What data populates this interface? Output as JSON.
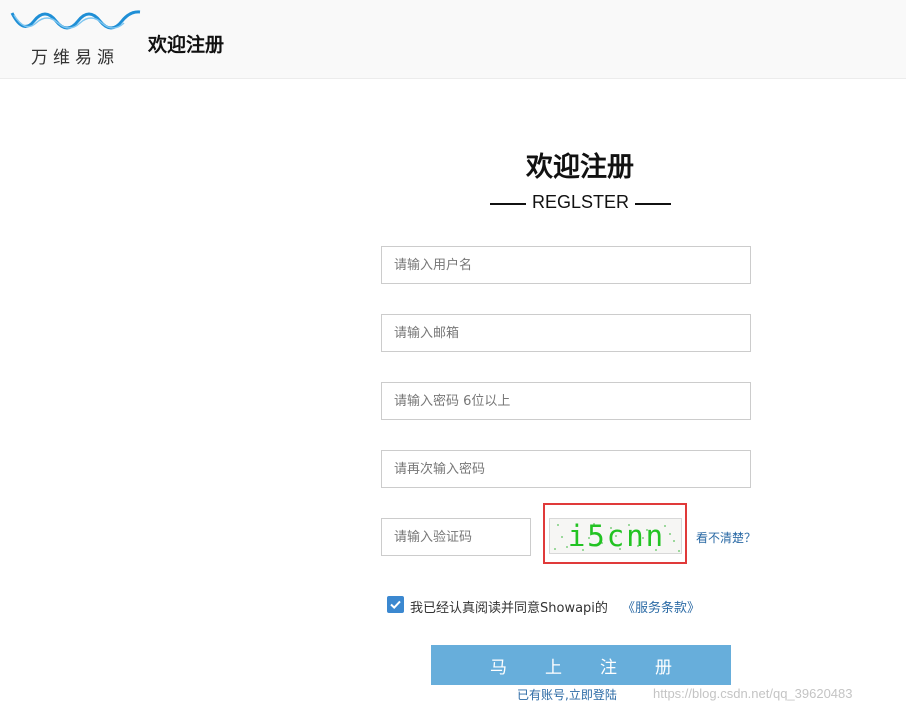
{
  "header": {
    "logo_text": "万维易源",
    "title": "欢迎注册"
  },
  "form": {
    "title": "欢迎注册",
    "subtitle": "REGLSTER",
    "username_placeholder": "请输入用户名",
    "email_placeholder": "请输入邮箱",
    "password_placeholder": "请输入密码 6位以上",
    "confirm_password_placeholder": "请再次输入密码",
    "captcha_placeholder": "请输入验证码",
    "captcha_text": "i5cnn",
    "captcha_unclear_link": "看不清楚？",
    "agree_checked": true,
    "agree_text": "我已经认真阅读并同意Showapi的",
    "terms_link": "《服务条款》",
    "submit_label": "马上注册",
    "login_link": "已有账号,立即登陆"
  },
  "watermark": "https://blog.csdn.net/qq_39620483",
  "colors": {
    "accent": "#67aedb",
    "link": "#2b6aa5",
    "checkbox": "#3b88d0",
    "highlight_box": "#e03a3a",
    "captcha_text": "#22c322"
  },
  "icons": {
    "logo": "wave-logo-icon",
    "checkbox": "checkmark-icon"
  }
}
